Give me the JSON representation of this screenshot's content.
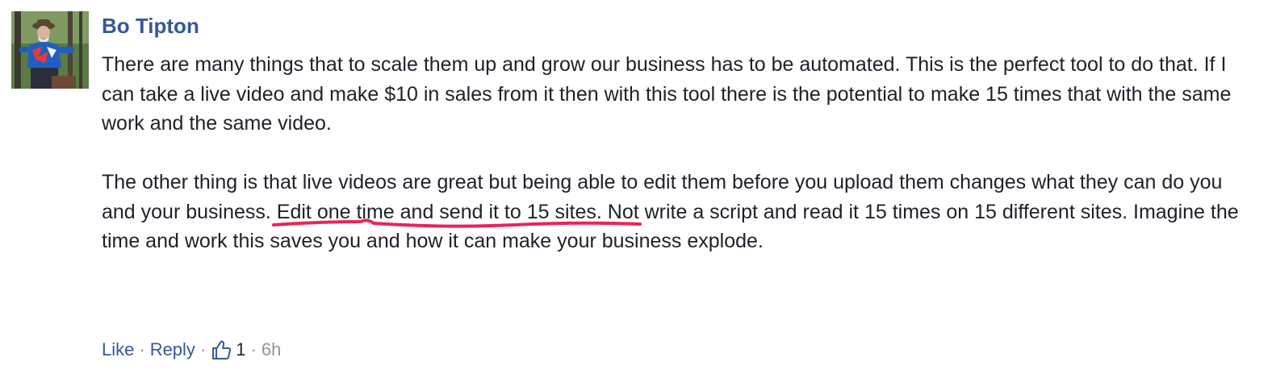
{
  "comment": {
    "author": "Bo Tipton",
    "paragraph1": "There are many things that to scale them up and grow our business has to be automated. This is the perfect tool to do that. If I can take a live video and make $10 in sales from it then with this tool there is the potential to make 15 times that with the same work and the same video.",
    "paragraph2_before": "The other thing is that live videos are great but being able to edit them before you upload them changes what they can do you and your business. ",
    "paragraph2_highlight": "Edit one time and send it to 15 sites.",
    "paragraph2_after": " Not write a script and read it 15 times on 15 different sites. Imagine the time and work this saves you and how it can make your business explode.",
    "underline_color": "#e8245c"
  },
  "actions": {
    "like_label": "Like",
    "reply_label": "Reply",
    "separator": "·",
    "like_count": "1",
    "timestamp": "6h",
    "like_icon": "thumbs-up-icon"
  },
  "colors": {
    "link": "#365899",
    "text": "#1d2129",
    "muted": "#90949c"
  }
}
